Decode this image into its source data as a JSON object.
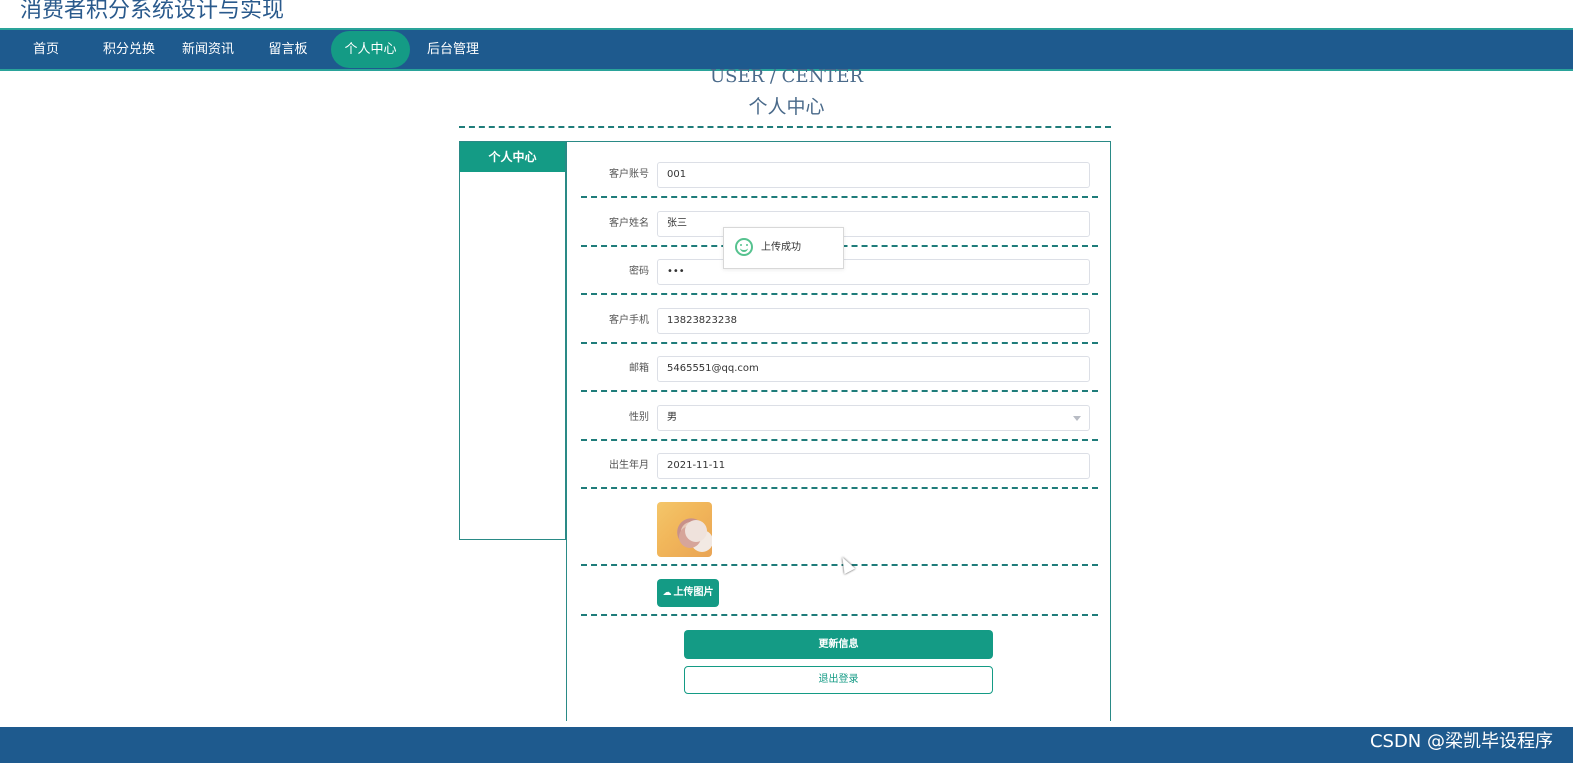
{
  "header": {
    "site_title": "消费者积分系统设计与实现"
  },
  "nav": {
    "items": [
      {
        "label": "首页",
        "active": false
      },
      {
        "label": "积分兑换",
        "active": false
      },
      {
        "label": "新闻资讯",
        "active": false
      },
      {
        "label": "留言板",
        "active": false
      },
      {
        "label": "个人中心",
        "active": true
      },
      {
        "label": "后台管理",
        "active": false
      }
    ]
  },
  "section": {
    "title_en": "USER / CENTER",
    "title_cn": "个人中心"
  },
  "sidebar": {
    "title": "个人中心"
  },
  "form": {
    "account": {
      "label": "客户账号",
      "value": "001"
    },
    "name": {
      "label": "客户姓名",
      "value": "张三"
    },
    "password": {
      "label": "密码",
      "value": "•••"
    },
    "phone": {
      "label": "客户手机",
      "value": "13823823238"
    },
    "email": {
      "label": "邮箱",
      "value": "5465551@qq.com"
    },
    "gender": {
      "label": "性别",
      "value": "男"
    },
    "birth": {
      "label": "出生年月",
      "value": "2021-11-11"
    },
    "upload_label": "上传图片",
    "update_label": "更新信息",
    "logout_label": "退出登录"
  },
  "toast": {
    "message": "上传成功"
  },
  "footer": {
    "watermark": "CSDN @梁凯毕设程序"
  },
  "colors": {
    "nav_bg": "#1e5a8e",
    "accent": "#149b85",
    "divider": "#1f7c7a"
  },
  "icons": [
    "smile-icon",
    "cloud-upload-icon",
    "chevron-down-icon",
    "mouse-cursor-icon"
  ]
}
